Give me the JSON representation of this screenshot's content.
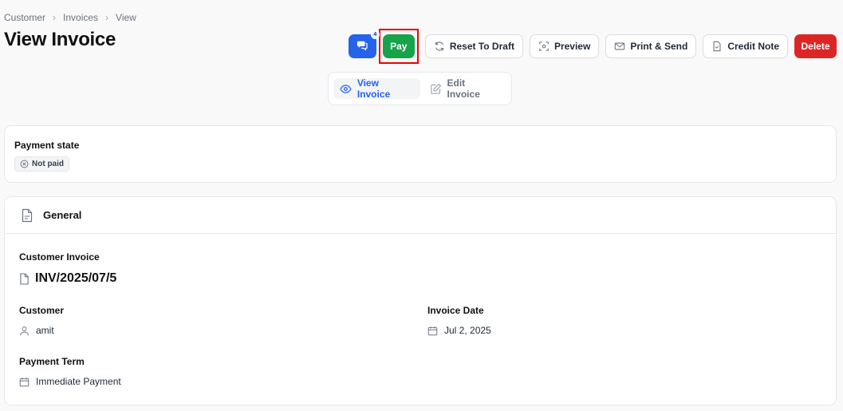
{
  "breadcrumb": [
    "Customer",
    "Invoices",
    "View"
  ],
  "page_title": "View Invoice",
  "toolbar": {
    "chat_badge": "4",
    "pay": "Pay",
    "reset_to_draft": "Reset To Draft",
    "preview": "Preview",
    "print_send": "Print & Send",
    "credit_note": "Credit Note",
    "delete": "Delete"
  },
  "view_tabs": {
    "view": "View Invoice",
    "edit": "Edit Invoice"
  },
  "payment_state": {
    "label": "Payment state",
    "badge": "Not paid"
  },
  "general": {
    "title": "General",
    "customer_invoice_label": "Customer Invoice",
    "invoice_number": "INV/2025/07/5",
    "customer_label": "Customer",
    "customer": "amit",
    "invoice_date_label": "Invoice Date",
    "invoice_date": "Jul 2, 2025",
    "payment_term_label": "Payment Term",
    "payment_term": "Immediate Payment"
  },
  "colors": {
    "primary": "#2563eb",
    "pay": "#16a34a",
    "delete": "#dc2626",
    "highlight": "#ee0000"
  }
}
